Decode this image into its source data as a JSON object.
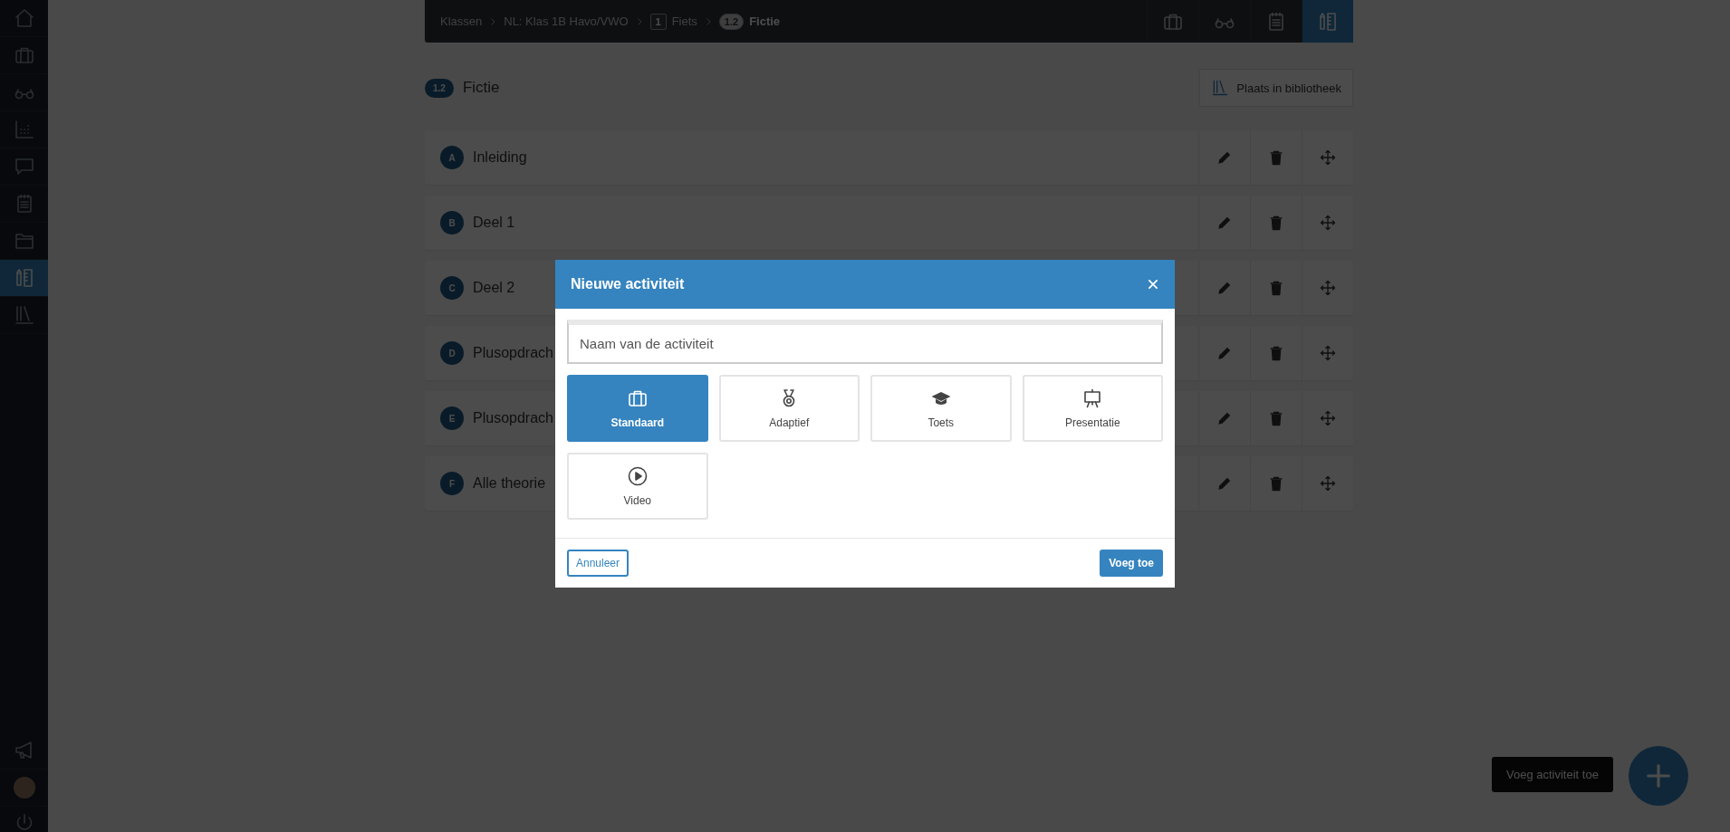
{
  "sidebar": {
    "items": [
      {
        "selected": false
      },
      {
        "selected": false
      },
      {
        "selected": false
      },
      {
        "selected": false
      },
      {
        "selected": false
      },
      {
        "selected": false
      },
      {
        "selected": false
      },
      {
        "selected": true
      },
      {
        "selected": false
      }
    ]
  },
  "breadcrumb": [
    {
      "label": "Klassen",
      "current": false
    },
    {
      "label": "NL: Klas 1B Havo/VWO",
      "current": false
    },
    {
      "badge": "1",
      "label": "Fiets",
      "current": false
    },
    {
      "badge": "1.2",
      "label": "Fictie",
      "current": true
    }
  ],
  "header_tools": [
    {
      "selected": false
    },
    {
      "selected": false
    },
    {
      "selected": false
    },
    {
      "selected": true
    }
  ],
  "page": {
    "badge": "1.2",
    "title": "Fictie",
    "library_button": "Plaats in bibliotheek"
  },
  "sections": [
    {
      "letter": "A",
      "title": "Inleiding"
    },
    {
      "letter": "B",
      "title": "Deel 1"
    },
    {
      "letter": "C",
      "title": "Deel 2"
    },
    {
      "letter": "D",
      "title": "Plusopdrach"
    },
    {
      "letter": "E",
      "title": "Plusopdrach"
    },
    {
      "letter": "F",
      "title": "Alle theorie"
    }
  ],
  "modal": {
    "title": "Nieuwe activiteit",
    "name_field": {
      "placeholder": "Naam van de activiteit"
    },
    "types": [
      {
        "label": "Standaard",
        "selected": true
      },
      {
        "label": "Adaptief",
        "selected": false
      },
      {
        "label": "Toets",
        "selected": false
      },
      {
        "label": "Presentatie",
        "selected": false
      },
      {
        "label": "Video",
        "selected": false
      }
    ],
    "cancel": "Annuleer",
    "submit": "Voeg toe"
  },
  "tooltip": "Voeg activiteit toe"
}
